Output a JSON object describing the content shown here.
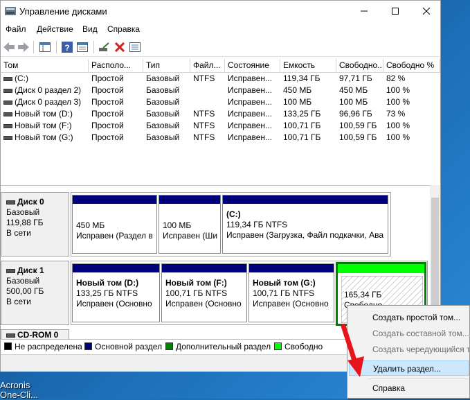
{
  "window": {
    "title": "Управление дисками"
  },
  "menu": [
    "Файл",
    "Действие",
    "Вид",
    "Справка"
  ],
  "columns": [
    "Том",
    "Располо...",
    "Тип",
    "Файл...",
    "Состояние",
    "Емкость",
    "Свободно...",
    "Свободно %"
  ],
  "volumes": [
    [
      "(C:)",
      "Простой",
      "Базовый",
      "NTFS",
      "Исправен...",
      "119,34 ГБ",
      "97,71 ГБ",
      "82 %"
    ],
    [
      "(Диск 0 раздел 2)",
      "Простой",
      "Базовый",
      "",
      "Исправен...",
      "450 МБ",
      "450 МБ",
      "100 %"
    ],
    [
      "(Диск 0 раздел 3)",
      "Простой",
      "Базовый",
      "",
      "Исправен...",
      "100 МБ",
      "100 МБ",
      "100 %"
    ],
    [
      "Новый том (D:)",
      "Простой",
      "Базовый",
      "NTFS",
      "Исправен...",
      "133,25 ГБ",
      "96,96 ГБ",
      "73 %"
    ],
    [
      "Новый том (F:)",
      "Простой",
      "Базовый",
      "NTFS",
      "Исправен...",
      "100,71 ГБ",
      "100,59 ГБ",
      "100 %"
    ],
    [
      "Новый том (G:)",
      "Простой",
      "Базовый",
      "NTFS",
      "Исправен...",
      "100,71 ГБ",
      "100,59 ГБ",
      "100 %"
    ]
  ],
  "disks": [
    {
      "name": "Диск 0",
      "type": "Базовый",
      "size": "119,88 ГБ",
      "status": "В сети",
      "partitions": [
        {
          "title": "",
          "size": "450 МБ",
          "status": "Исправен (Раздел в"
        },
        {
          "title": "",
          "size": "100 МБ",
          "status": "Исправен (Ши"
        },
        {
          "title": "(C:)",
          "size": "119,34 ГБ NTFS",
          "status": "Исправен (Загрузка, Файл подкачки, Ава"
        }
      ]
    },
    {
      "name": "Диск 1",
      "type": "Базовый",
      "size": "500,00 ГБ",
      "status": "В сети",
      "partitions": [
        {
          "title": "Новый том  (D:)",
          "size": "133,25 ГБ NTFS",
          "status": "Исправен (Основно"
        },
        {
          "title": "Новый том  (F:)",
          "size": "100,71 ГБ NTFS",
          "status": "Исправен (Основно"
        },
        {
          "title": "Новый том  (G:)",
          "size": "100,71 ГБ NTFS",
          "status": "Исправен (Основно"
        },
        {
          "title": "",
          "size": "165,34 ГБ",
          "status": "Свободно"
        }
      ]
    },
    {
      "name": "CD-ROM 0"
    }
  ],
  "legend": [
    {
      "label": "Не распределена",
      "color": "#000000"
    },
    {
      "label": "Основной раздел",
      "color": "#00007b"
    },
    {
      "label": "Дополнительный раздел",
      "color": "#008000"
    },
    {
      "label": "Свободно",
      "color": "#00ff00"
    }
  ],
  "context_menu": [
    {
      "label": "Создать простой том...",
      "enabled": true
    },
    {
      "label": "Создать составной том...",
      "enabled": false
    },
    {
      "label": "Создать чередующийся том...",
      "enabled": false
    },
    {
      "label": "Удалить раздел...",
      "enabled": true,
      "highlighted": true
    },
    {
      "label": "Справка",
      "enabled": true
    }
  ],
  "desktop": {
    "label_1": "Acronis",
    "label_2": "One-Cli..."
  },
  "colors": {
    "primary": "#00007b",
    "extended": "#008000",
    "free": "#00ff00",
    "arrow": "#e8141c",
    "highlight": "#cce8ff"
  }
}
